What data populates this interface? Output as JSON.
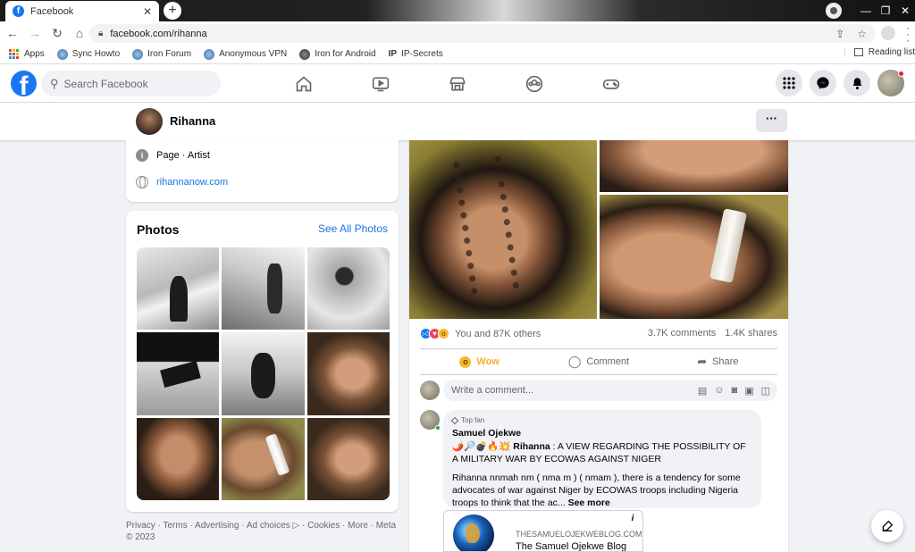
{
  "browser": {
    "tab_title": "Facebook",
    "tab_close": "✕",
    "new_tab": "+",
    "url": "facebook.com/rihanna",
    "bookmarks": [
      {
        "label": "Apps"
      },
      {
        "label": "Sync Howto"
      },
      {
        "label": "Iron Forum"
      },
      {
        "label": "Anonymous VPN"
      },
      {
        "label": "Iron for Android"
      },
      {
        "label": "IP-Secrets"
      }
    ],
    "reading_list": "Reading list"
  },
  "fb": {
    "logo": "f",
    "search_placeholder": "Search Facebook",
    "nav_icons": [
      "home-icon",
      "watch-icon",
      "marketplace-icon",
      "groups-icon",
      "gaming-icon"
    ],
    "brand_color": "#1877f2"
  },
  "page": {
    "name": "Rihanna",
    "more": "···"
  },
  "intro": {
    "category": "Page · Artist",
    "website": "rihannanow.com"
  },
  "photos": {
    "title": "Photos",
    "see_all": "See All Photos"
  },
  "footer": {
    "text": "Privacy · Terms · Advertising · Ad choices ▷ · Cookies · More · Meta © 2023"
  },
  "post": {
    "reactions_text": "You and 87K others",
    "comments_count": "3.7K comments",
    "shares_count": "1.4K shares",
    "actions": {
      "wow": "Wow",
      "comment": "Comment",
      "share": "Share"
    },
    "comment_placeholder": "Write a comment..."
  },
  "comment": {
    "badge": "Top fan",
    "author": "Samuel Ojekwe",
    "emoji_prefix": "🌶️🔎💣🔥💥",
    "mention": "Rihanna",
    "line1": " : A VIEW REGARDING THE POSSIBILITY OF A MILITARY WAR BY ECOWAS AGAINST NIGER",
    "line2": "Rihanna nnmah nm ( nma m ) ( nmam ), there is a tendency for some advocates of war against Niger by ECOWAS troops including Nigeria troops to think that the ac... ",
    "see_more": "See more"
  },
  "link_preview": {
    "source": "THESAMUELOJEKWEBLOG.COM",
    "title": "The Samuel Ojekwe Blog",
    "info": "i"
  }
}
